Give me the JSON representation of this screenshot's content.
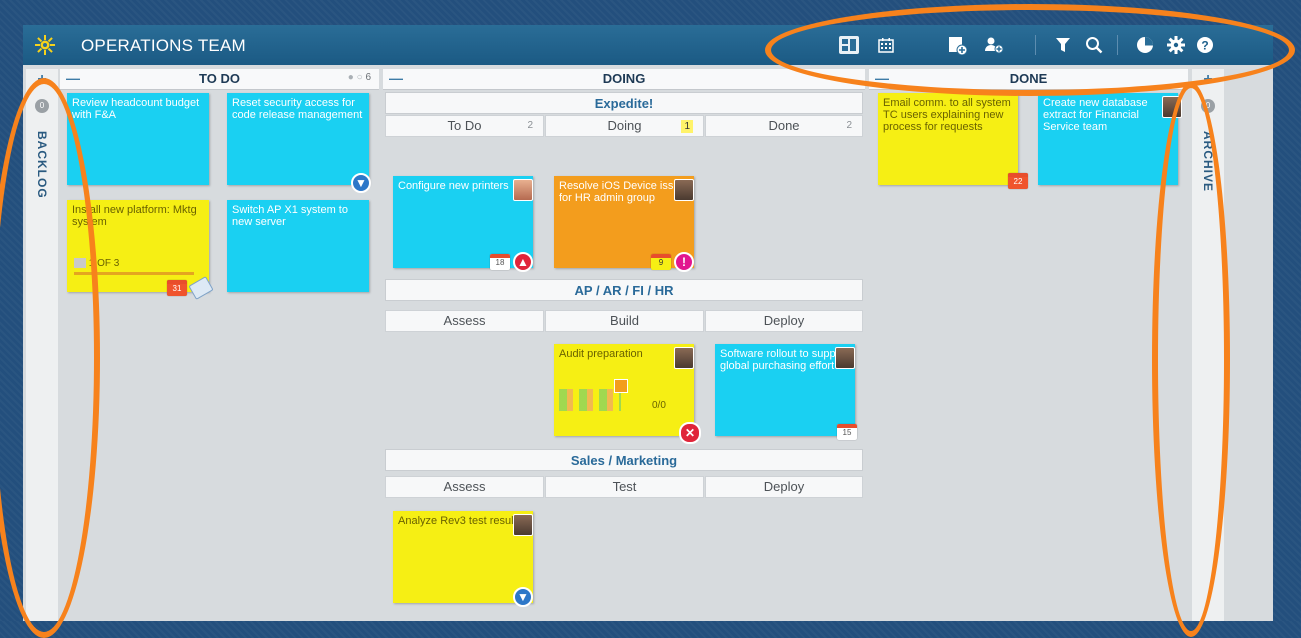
{
  "header": {
    "title": "OPERATIONS TEAM",
    "icons": [
      "board-view-icon",
      "calendar-view-icon",
      "add-card-icon",
      "add-user-icon",
      "filter-icon",
      "search-icon",
      "chart-icon",
      "settings-icon",
      "help-icon"
    ]
  },
  "backlog": {
    "label": "BACKLOG",
    "plus": "+",
    "badge": "0"
  },
  "archive": {
    "label": "ARCHIVE",
    "plus": "+",
    "badge": "0"
  },
  "columns": {
    "todo": {
      "name": "TO DO",
      "count": "6",
      "minus": "—"
    },
    "doing": {
      "name": "DOING",
      "minus": "—"
    },
    "done": {
      "name": "DONE",
      "minus": "—"
    }
  },
  "lanes": {
    "expedite": {
      "title": "Expedite!",
      "subs": [
        {
          "label": "To Do",
          "count": "2"
        },
        {
          "label": "Doing",
          "count": "1"
        },
        {
          "label": "Done",
          "count": "2"
        }
      ]
    },
    "ap": {
      "title": "AP / AR / FI / HR",
      "subs": [
        {
          "label": "Assess"
        },
        {
          "label": "Build"
        },
        {
          "label": "Deploy"
        }
      ]
    },
    "sales": {
      "title": "Sales / Marketing",
      "subs": [
        {
          "label": "Assess"
        },
        {
          "label": "Test"
        },
        {
          "label": "Deploy"
        }
      ]
    }
  },
  "cards": {
    "c1": {
      "text": "Review headcount budget with F&A"
    },
    "c2": {
      "text": "Reset security access for code release management"
    },
    "c3": {
      "text": "Install new platform: Mktg system",
      "progress": "1 OF 3",
      "date": "31"
    },
    "c4": {
      "text": "Switch AP X1 system to new server"
    },
    "c5": {
      "text": "Configure new printers",
      "date": "18"
    },
    "c6": {
      "text": "Resolve iOS Device issue for HR admin group",
      "date": "9"
    },
    "c7": {
      "text": "Audit preparation",
      "tasks": "0/0"
    },
    "c8": {
      "text": "Software rollout to support global purchasing effort",
      "date": "15"
    },
    "c9": {
      "text": "Analyze Rev3 test results"
    },
    "c10": {
      "text": "Email comm. to all system TC users explaining new process for requests",
      "date": "22"
    },
    "c11": {
      "text": "Create new database extract for Financial Service team"
    }
  },
  "colors": {
    "cyan": "#1ad0f2",
    "yellow": "#f6ef14",
    "orange": "#f39d1d",
    "highlight_ring": "#f7821c"
  }
}
